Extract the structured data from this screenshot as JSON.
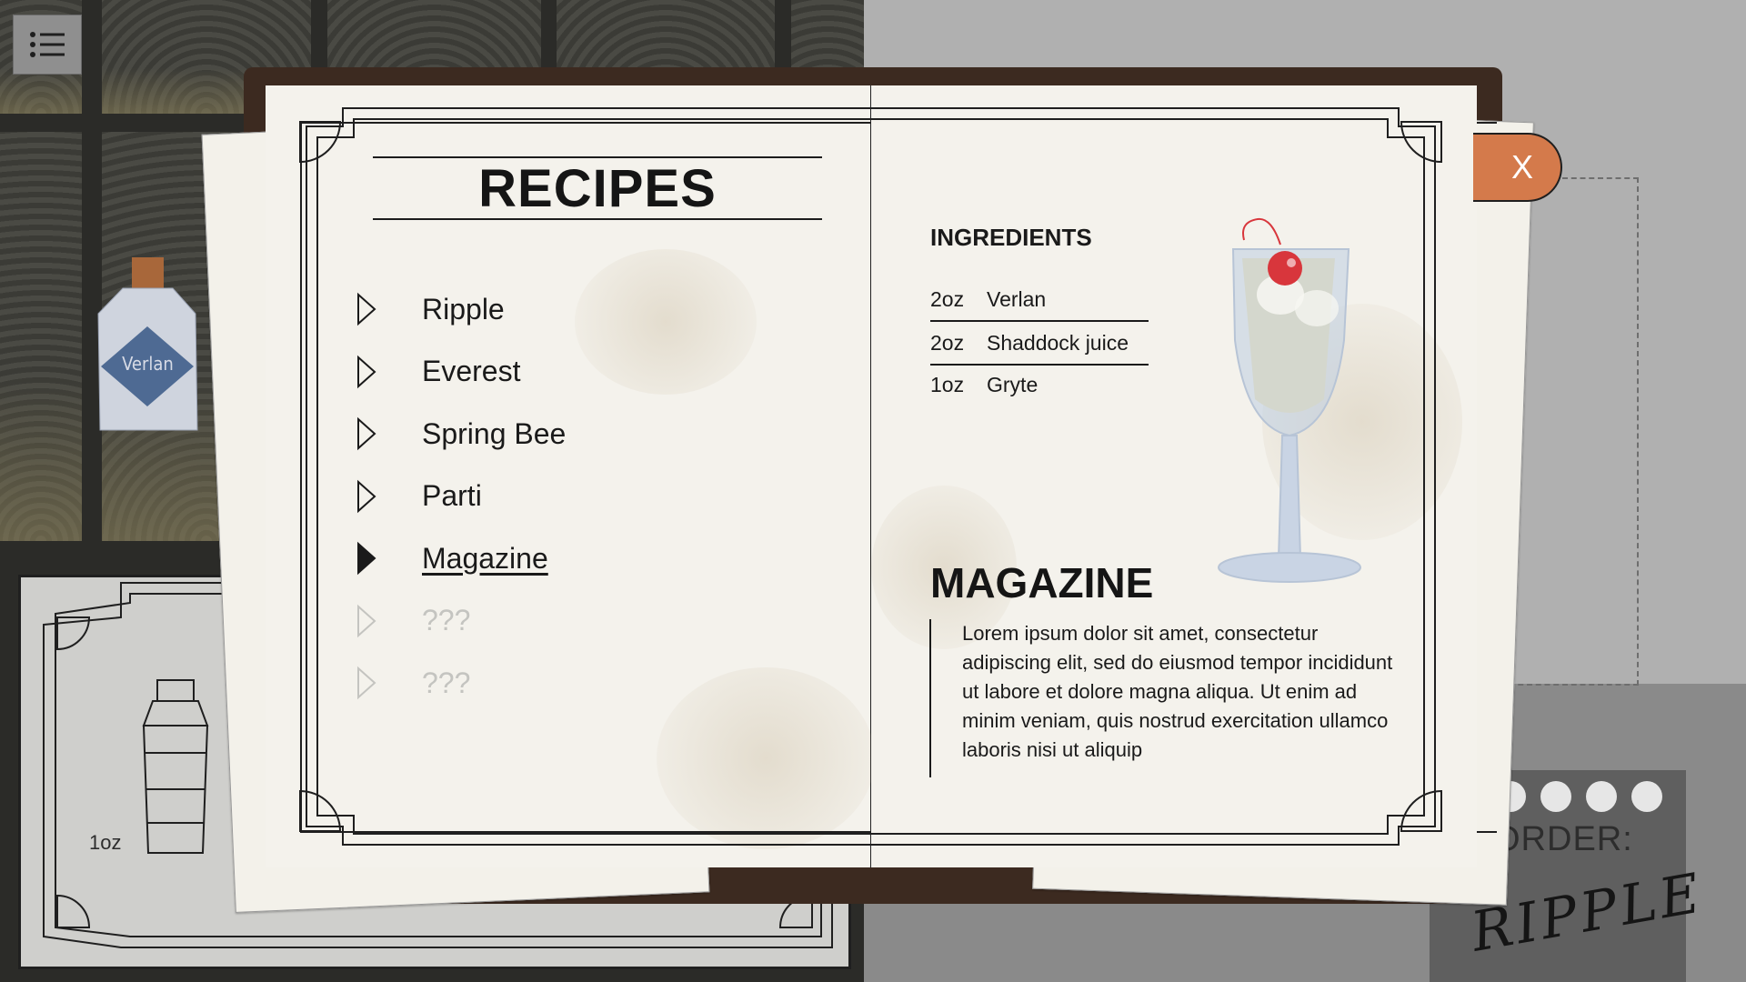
{
  "scene": {
    "bottle_label": "Verlan",
    "measure_label": "1oz",
    "order_title": "ORDER:",
    "order_name": "RIPPLE",
    "order_dots": 4
  },
  "book": {
    "title": "RECIPES",
    "recipes": [
      {
        "name": "Ripple",
        "state": "normal"
      },
      {
        "name": "Everest",
        "state": "normal"
      },
      {
        "name": "Spring Bee",
        "state": "normal"
      },
      {
        "name": "Parti",
        "state": "normal"
      },
      {
        "name": "Magazine",
        "state": "selected"
      },
      {
        "name": "???",
        "state": "locked"
      },
      {
        "name": "???",
        "state": "locked"
      }
    ],
    "ingredients_title": "INGREDIENTS",
    "ingredients": [
      {
        "amount": "2oz",
        "name": "Verlan"
      },
      {
        "amount": "2oz",
        "name": "Shaddock juice"
      },
      {
        "amount": "1oz",
        "name": "Gryte"
      }
    ],
    "selected_drink": "MAGAZINE",
    "description": "Lorem ipsum dolor sit amet, consectetur adipiscing elit, sed do eiusmod tempor incididunt ut labore et dolore magna aliqua. Ut enim ad minim veniam, quis nostrud exercitation ullamco laboris nisi ut aliquip",
    "close_label": "X"
  },
  "icons": {
    "menu": "list-icon",
    "recipe_marker": "triangle-play-icon",
    "drink": "champagne-flute-icon"
  },
  "colors": {
    "close_button": "#d47a4b",
    "bottle_label": "#4e6a93",
    "bottle_cap": "#a8673a",
    "cherry": "#d8363c",
    "drink_fill": "#efe2b4",
    "book_cover": "#3c2a20",
    "page": "#f4f2ec",
    "locked_text": "#c4c4c0"
  }
}
